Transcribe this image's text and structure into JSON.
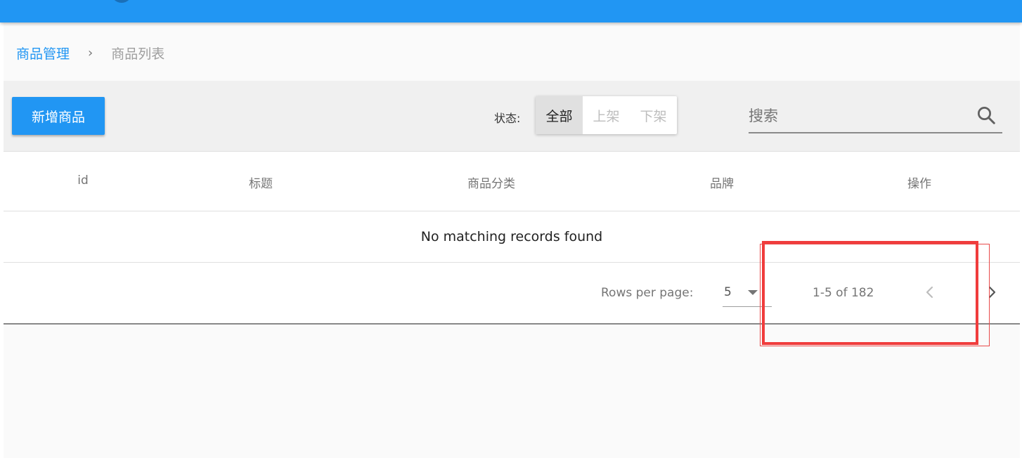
{
  "breadcrumb": {
    "parent": "商品管理",
    "separator": "›",
    "current": "商品列表"
  },
  "toolbar": {
    "add_button_label": "新增商品",
    "status_label": "状态:",
    "status_options": [
      "全部",
      "上架",
      "下架"
    ],
    "status_selected": "全部",
    "search_placeholder": "搜索"
  },
  "table": {
    "columns": [
      "id",
      "标题",
      "商品分类",
      "品牌",
      "操作"
    ],
    "empty_message": "No matching records found"
  },
  "pagination": {
    "rows_per_page_label": "Rows per page:",
    "rows_per_page_value": "5",
    "range_text": "1-5 of 182"
  },
  "colors": {
    "primary": "#2196f3",
    "annotation": "#f03c3c"
  },
  "icons": {
    "search": "search-icon",
    "prev": "chevron-left-icon",
    "next": "chevron-right-icon",
    "dropdown": "dropdown-arrow-icon"
  }
}
